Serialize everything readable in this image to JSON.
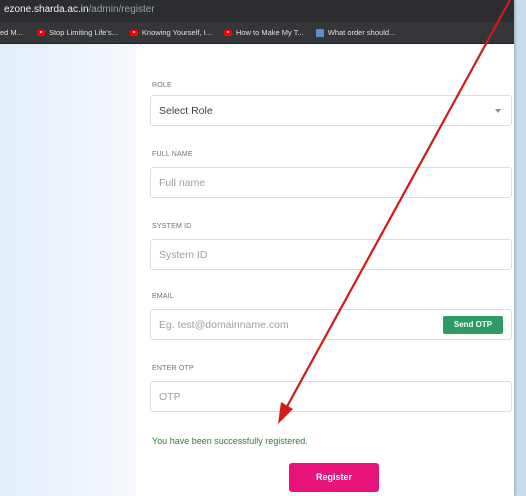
{
  "browser": {
    "url_host": "ezone.sharda.ac.in",
    "url_path": "/admin/register",
    "bookmarks": [
      {
        "label": "ed M...",
        "icon": "none"
      },
      {
        "label": "Stop Limiting Life's...",
        "icon": "youtube-icon"
      },
      {
        "label": "Knowing Yourself, I...",
        "icon": "youtube-icon"
      },
      {
        "label": "How to Make My T...",
        "icon": "youtube-icon"
      },
      {
        "label": "What order should...",
        "icon": "document-icon"
      }
    ]
  },
  "form": {
    "role": {
      "label": "ROLE",
      "value": "Select Role"
    },
    "full_name": {
      "label": "FULL NAME",
      "placeholder": "Full name"
    },
    "system_id": {
      "label": "SYSTEM ID",
      "placeholder": "System ID"
    },
    "email": {
      "label": "EMAIL",
      "placeholder": "Eg. test@domainname.com",
      "send_otp_label": "Send OTP"
    },
    "otp": {
      "label": "ENTER OTP",
      "placeholder": "OTP"
    },
    "success_message": "You have been successfully registered.",
    "register_label": "Register"
  },
  "colors": {
    "success_text": "#2f7d32",
    "send_otp_button": "#2e9a66",
    "register_button": "#e8127b",
    "annotation_arrow": "#d11a1a"
  }
}
